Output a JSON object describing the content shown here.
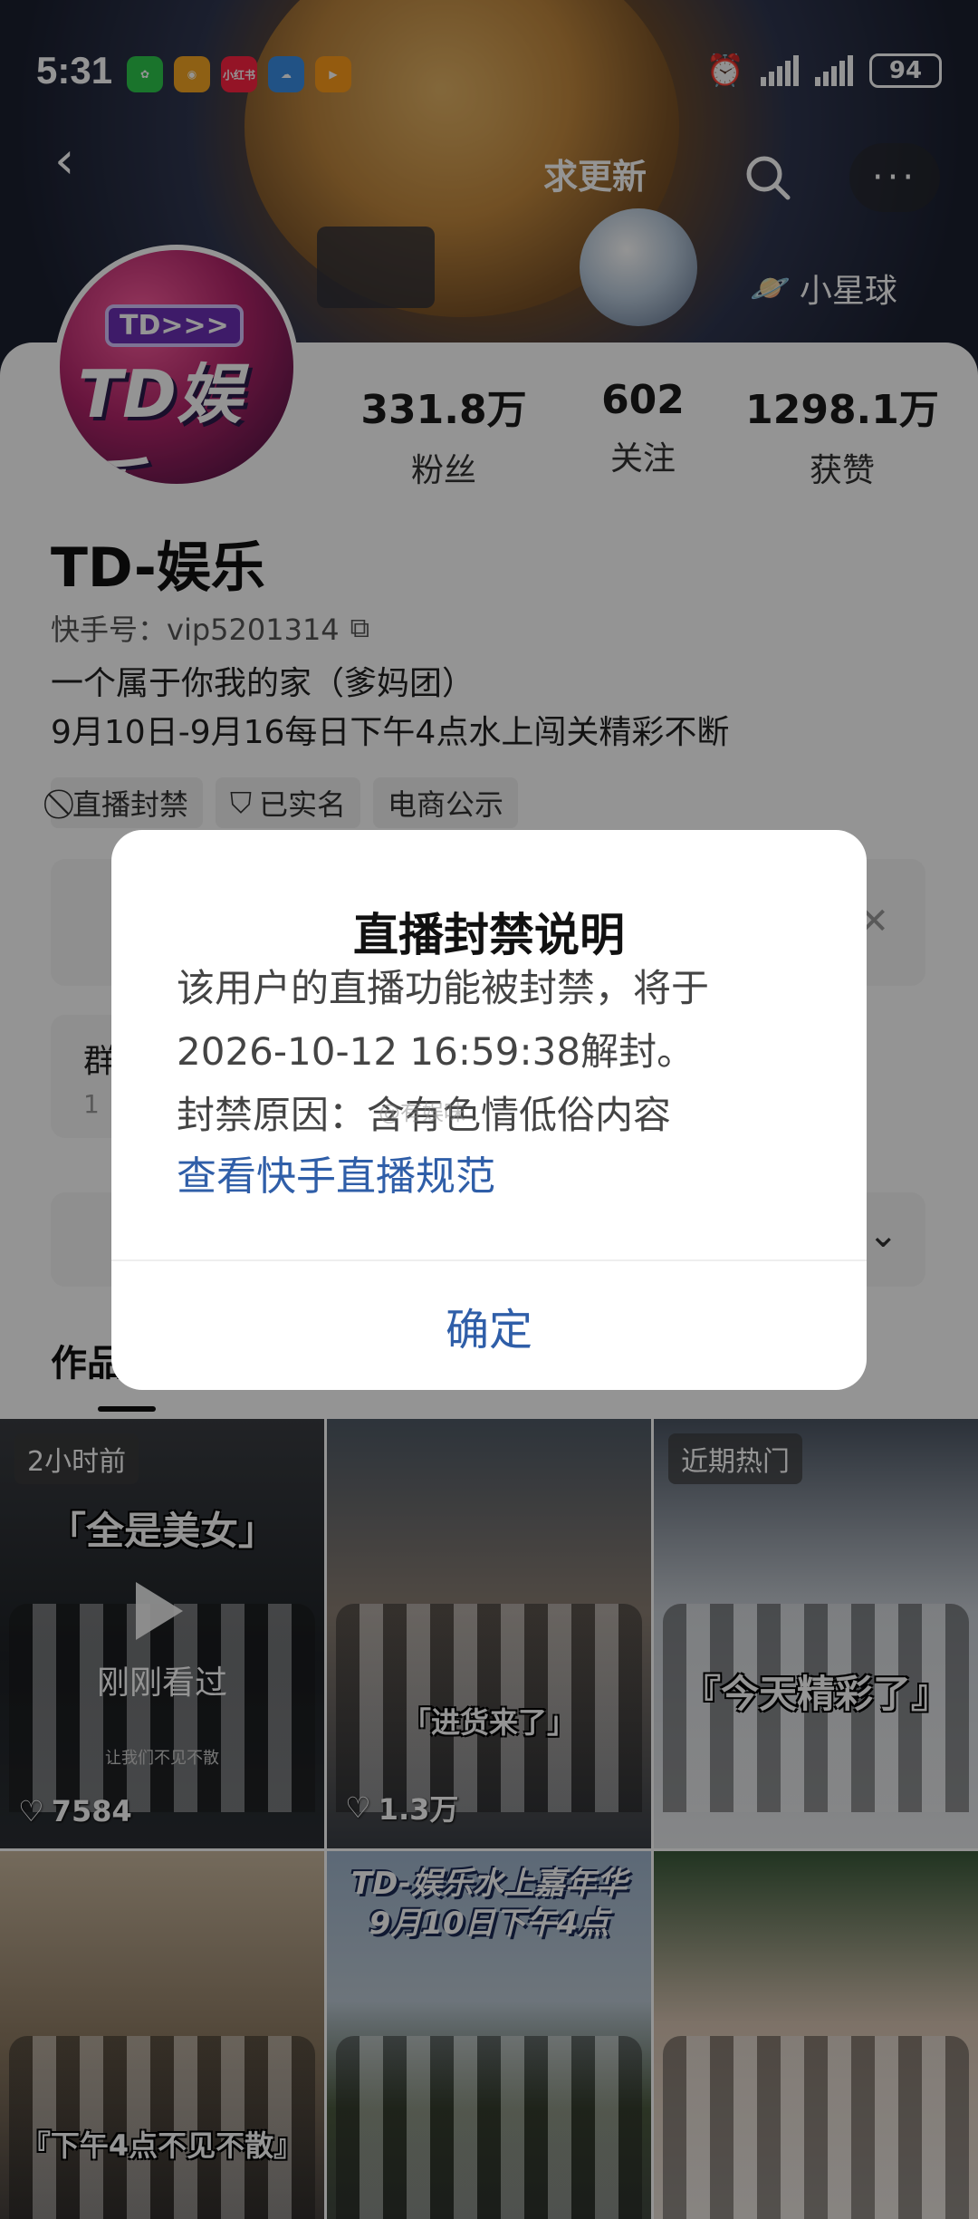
{
  "status_bar": {
    "time": "5:31",
    "apps": [
      {
        "name": "wechat-icon",
        "color": "#2dc84d",
        "label": ""
      },
      {
        "name": "weibo-icon",
        "color": "#f5a623",
        "label": ""
      },
      {
        "name": "xiaohongshu-icon",
        "color": "#ff2442",
        "label": "小红书"
      },
      {
        "name": "weather-icon",
        "color": "#3a8ee6",
        "label": ""
      },
      {
        "name": "video-app-icon",
        "color": "#ff9d1a",
        "label": ""
      }
    ],
    "battery": "94"
  },
  "header": {
    "update_label": "求更新",
    "planet_label": "小星球"
  },
  "profile": {
    "avatar_tag": "TD>>>",
    "avatar_text": "TD娱乐",
    "name": "TD-娱乐",
    "kuaishou_id": "快手号：vip5201314",
    "bio_lines": [
      "一个属于你我的家（爹妈团）",
      "9月10日-9月16每日下午4点水上闯关精彩不断"
    ],
    "tags": [
      {
        "icon": "ban-icon",
        "label": "直播封禁"
      },
      {
        "icon": "verified-shield-icon",
        "label": "已实名"
      },
      {
        "icon": "",
        "label": "电商公示"
      }
    ]
  },
  "stats": [
    {
      "value": "331.8万",
      "label": "粉丝"
    },
    {
      "value": "602",
      "label": "关注"
    },
    {
      "value": "1298.1万",
      "label": "获赞"
    }
  ],
  "group_card": {
    "title": "群",
    "sub": "1"
  },
  "tabs": {
    "works": "作品"
  },
  "grid": [
    {
      "badge": "2小时前",
      "caption": "「全是美女」",
      "watched": "刚刚看过",
      "small": "让我们不见不散",
      "likes": "7584"
    },
    {
      "badge": "",
      "caption": "「进货来了」",
      "likes": "1.3万"
    },
    {
      "badge": "近期热门",
      "caption": "『今天精彩了』",
      "likes": ""
    },
    {
      "badge": "",
      "caption": "『下午4点不见不散』",
      "likes": ""
    },
    {
      "badge": "",
      "poster": "TD-娱乐水上嘉年华\n9月10日下午4点",
      "likes": ""
    },
    {
      "badge": "",
      "caption": "",
      "likes": ""
    }
  ],
  "dialog": {
    "title": "直播封禁说明",
    "body_lines": [
      "该用户的直播功能被封禁，将于",
      "2026-10-12 16:59:38解封。",
      "封禁原因：含有色情低俗内容"
    ],
    "link": "查看快手直播规范",
    "confirm": "确定"
  },
  "watermark": "@有娱味"
}
